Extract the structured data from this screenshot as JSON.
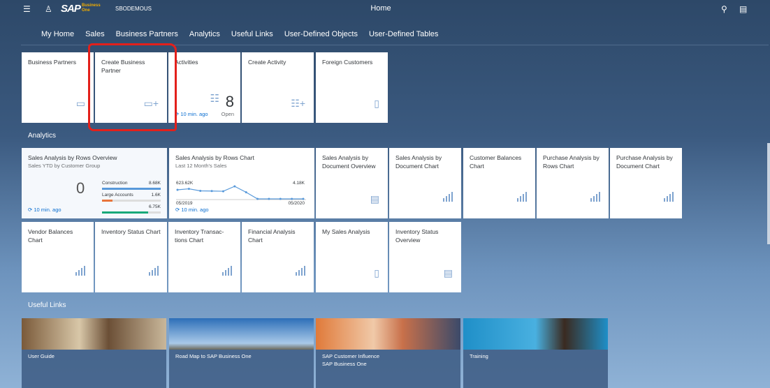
{
  "header": {
    "company": "SBODEMOUS",
    "title": "Home",
    "logo": "SAP Business One",
    "icons": [
      "menu-icon",
      "user-icon",
      "search-icon",
      "notifications-icon"
    ]
  },
  "nav": [
    "My Home",
    "Sales",
    "Business Partners",
    "Analytics",
    "Useful Links",
    "User-Defined Objects",
    "User-Defined Tables"
  ],
  "nav_selected": "Business Partners",
  "bp_tiles": [
    {
      "title": "Business Partners",
      "icon": "contact-card-icon"
    },
    {
      "title": "Create Business Partner",
      "icon": "add-contact-icon"
    },
    {
      "title": "Activities",
      "icon": "task-list-icon",
      "count": "8",
      "refresh": "10 min. ago",
      "status": "Open"
    },
    {
      "title": "Create Activity",
      "icon": "add-activity-icon"
    },
    {
      "title": "Foreign Customers",
      "icon": "bookmark-icon"
    }
  ],
  "sections": {
    "analytics": "Analytics",
    "links": "Useful Links"
  },
  "overview": {
    "title": "Sales Analysis by Rows Overview",
    "subtitle": "Sales YTD by Customer Group",
    "value": "0",
    "refresh": "10 min. ago",
    "bars": [
      {
        "label": "Construction",
        "value": "8.68K",
        "fraction": 1.0,
        "color": "#5899da"
      },
      {
        "label": "Large Accounts",
        "value": "1.6K",
        "fraction": 0.18,
        "color": "#e8743b"
      },
      {
        "label": "",
        "value": "6.75K",
        "fraction": 0.78,
        "color": "#19a979"
      }
    ]
  },
  "chart": {
    "title": "Sales Analysis by Rows Chart",
    "subtitle": "Last 12 Month's Sales",
    "max_label": "623.62K",
    "min_label": "4.18K",
    "start": "05/2019",
    "end": "05/2020",
    "refresh": "10 min. ago",
    "values": [
      450,
      500,
      400,
      390,
      380,
      623,
      330,
      4.18,
      4.18,
      4.18,
      4.18,
      4.18
    ]
  },
  "analytics_tiles": [
    {
      "title": "Sales Analysis by Document Overview",
      "icon": "report-icon"
    },
    {
      "title": "Sales Analysis by Document Chart",
      "icon": "bar-chart-icon"
    },
    {
      "title": "Customer Balances Chart",
      "icon": "bar-chart-icon"
    },
    {
      "title": "Purchase Analysis by Rows Chart",
      "icon": "bar-chart-icon"
    },
    {
      "title": "Purchase Analysis by Document Chart",
      "icon": "bar-chart-icon"
    },
    {
      "title": "Vendor Balances Chart",
      "icon": "bar-chart-icon"
    },
    {
      "title": "Inventory Status Chart",
      "icon": "bar-chart-icon"
    },
    {
      "title": "Inventory Transac-tions Chart",
      "icon": "bar-chart-icon"
    },
    {
      "title": "Financial Analysis Chart",
      "icon": "bar-chart-icon"
    },
    {
      "title": "My Sales Analysis",
      "icon": "bookmark-icon"
    },
    {
      "title": "Inventory Status Overview",
      "icon": "report-icon"
    }
  ],
  "links": [
    {
      "title": "User Guide",
      "sub": ""
    },
    {
      "title": "Road Map to SAP Business One",
      "sub": ""
    },
    {
      "title": "SAP Customer Influence",
      "sub": "SAP Business One"
    },
    {
      "title": "Training",
      "sub": ""
    }
  ],
  "colors": {
    "accent": "#0a6ed1",
    "annotation": "#e3201b",
    "header": "#2d4868"
  }
}
